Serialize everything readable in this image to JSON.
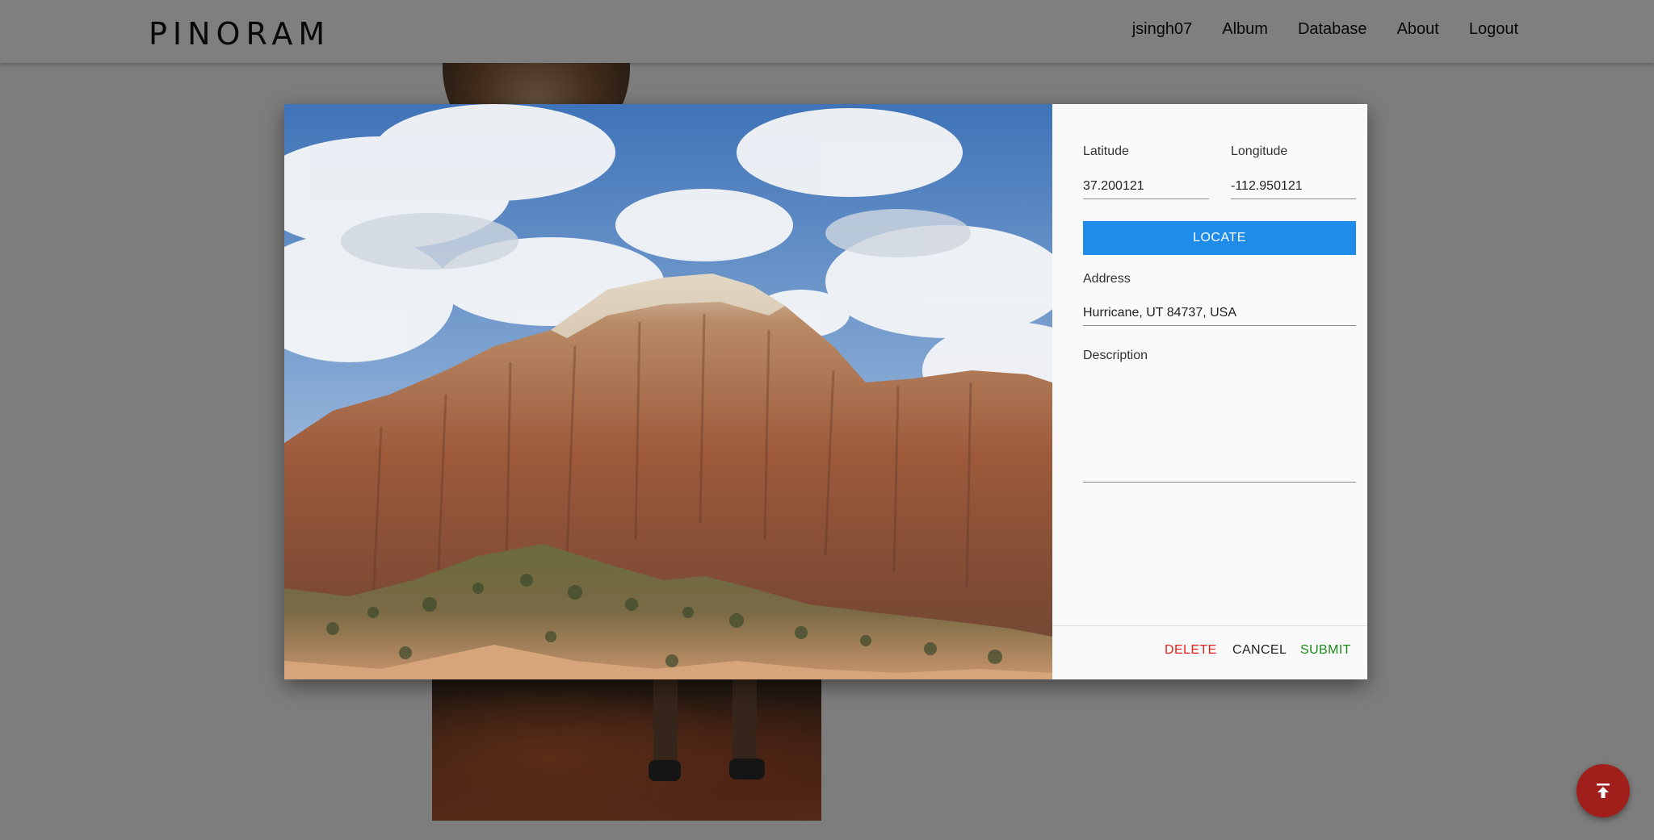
{
  "navbar": {
    "brand": "PINORAM",
    "links": [
      "jsingh07",
      "Album",
      "Database",
      "About",
      "Logout"
    ]
  },
  "modal": {
    "latitude": {
      "label": "Latitude",
      "value": "37.200121"
    },
    "longitude": {
      "label": "Longitude",
      "value": "-112.950121"
    },
    "locate_label": "LOCATE",
    "address": {
      "label": "Address",
      "value": "Hurricane, UT 84737, USA"
    },
    "description": {
      "label": "Description",
      "value": ""
    },
    "actions": {
      "delete_label": "DELETE",
      "cancel_label": "CANCEL",
      "submit_label": "SUBMIT"
    }
  },
  "fab": {
    "icon": "scroll-to-top-icon"
  },
  "colors": {
    "locate_bg": "#1e8ce8",
    "delete": "#e8201c",
    "cancel": "#222222",
    "submit": "#1a8a1a",
    "fab_bg": "#a11f1b"
  }
}
